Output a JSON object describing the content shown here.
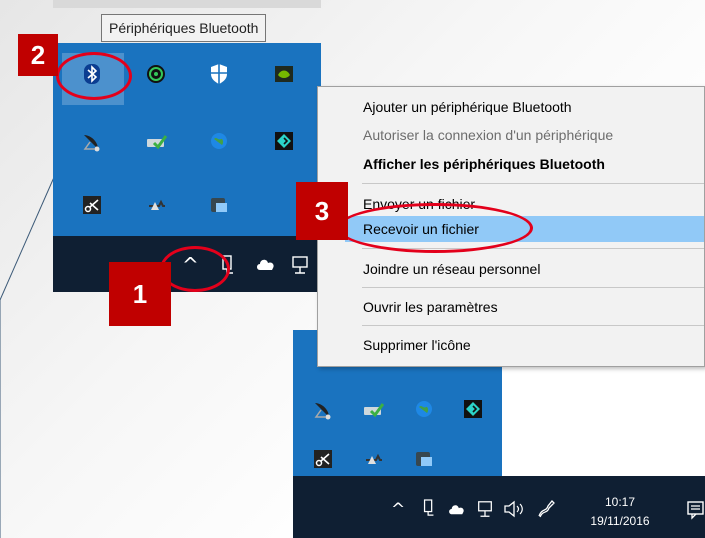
{
  "tooltip": {
    "text": "Périphériques Bluetooth"
  },
  "context_menu": {
    "items": [
      {
        "label": "Ajouter un périphérique Bluetooth"
      },
      {
        "label": "Autoriser la connexion d'un périphérique"
      },
      {
        "label": "Afficher les périphériques Bluetooth"
      },
      {
        "label": "Envoyer un fichier"
      },
      {
        "label": "Recevoir un fichier"
      },
      {
        "label": "Joindre un réseau personnel"
      },
      {
        "label": "Ouvrir les paramètres"
      },
      {
        "label": "Supprimer l'icône"
      }
    ]
  },
  "callouts": {
    "step1": "1",
    "step2": "2",
    "step3": "3"
  },
  "taskbar": {
    "show_hidden_icon": "^",
    "clock_time": "10:17",
    "clock_date": "19/11/2016"
  },
  "tray_icons": [
    "bluetooth-icon",
    "antivirus-ring-icon",
    "shield-icon",
    "nvidia-icon",
    "satellite-icon",
    "drive-check-icon",
    "globe-icon",
    "app-diamond-icon",
    "scissors-icon",
    "usb-eject-icon",
    "network-share-icon"
  ],
  "colors": {
    "tray_blue": "#1a73bf",
    "taskbar_dark": "#0f1f33",
    "menu_bg": "#f2f2f2",
    "menu_highlight": "#91c9f7",
    "callout_red": "#c00000"
  }
}
